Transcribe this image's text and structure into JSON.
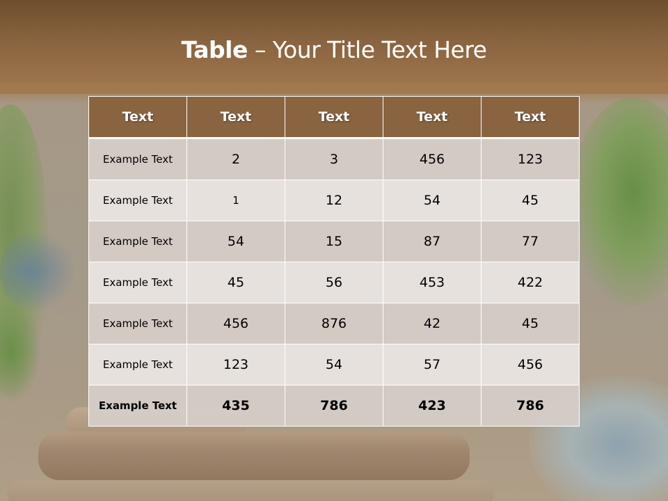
{
  "title": {
    "bold": "Table",
    "rest": " – Your Title Text Here"
  },
  "table": {
    "headers": [
      "Text",
      "Text",
      "Text",
      "Text",
      "Text"
    ],
    "rows": [
      [
        "Example Text",
        "2",
        "3",
        "456",
        "123"
      ],
      [
        "Example Text",
        "1",
        "12",
        "54",
        "45"
      ],
      [
        "Example Text",
        "54",
        "15",
        "87",
        "77"
      ],
      [
        "Example Text",
        "45",
        "56",
        "453",
        "422"
      ],
      [
        "Example Text",
        "456",
        "876",
        "42",
        "45"
      ],
      [
        "Example Text",
        "123",
        "54",
        "57",
        "456"
      ],
      [
        "Example Text",
        "435",
        "786",
        "423",
        "786"
      ]
    ]
  },
  "colors": {
    "header_brown": "#8a6440",
    "row_dark": "#d6cdc8",
    "row_light": "#eae5e2",
    "title_text": "#ffffff"
  }
}
